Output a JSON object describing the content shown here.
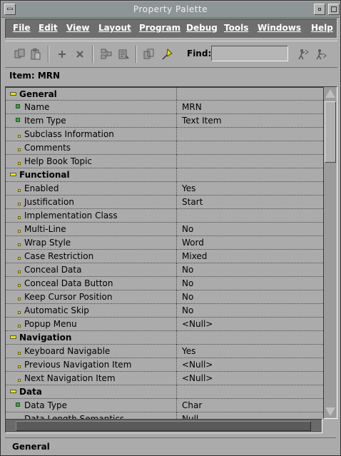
{
  "window": {
    "title": "Property Palette"
  },
  "menu": [
    "File",
    "Edit",
    "View",
    "Layout",
    "Program",
    "Debug",
    "Tools",
    "Windows",
    "Help"
  ],
  "toolbar": {
    "find_label": "Find:",
    "find_value": ""
  },
  "item": {
    "prefix": "Item:",
    "name": "MRN"
  },
  "rows": [
    {
      "type": "category",
      "name": "General",
      "value": ""
    },
    {
      "type": "prop",
      "marker": "set",
      "name": "Name",
      "value": "MRN"
    },
    {
      "type": "prop",
      "marker": "set",
      "name": "Item Type",
      "value": "Text Item"
    },
    {
      "type": "prop",
      "marker": "default",
      "name": "Subclass Information",
      "value": ""
    },
    {
      "type": "prop",
      "marker": "default",
      "name": "Comments",
      "value": ""
    },
    {
      "type": "prop",
      "marker": "default",
      "name": "Help Book Topic",
      "value": ""
    },
    {
      "type": "category",
      "name": "Functional",
      "value": ""
    },
    {
      "type": "prop",
      "marker": "default",
      "name": "Enabled",
      "value": "Yes"
    },
    {
      "type": "prop",
      "marker": "default",
      "name": "Justification",
      "value": "Start"
    },
    {
      "type": "prop",
      "marker": "default",
      "name": "Implementation Class",
      "value": ""
    },
    {
      "type": "prop",
      "marker": "default",
      "name": "Multi-Line",
      "value": "No"
    },
    {
      "type": "prop",
      "marker": "default",
      "name": "Wrap Style",
      "value": "Word"
    },
    {
      "type": "prop",
      "marker": "default",
      "name": "Case Restriction",
      "value": "Mixed"
    },
    {
      "type": "prop",
      "marker": "default",
      "name": "Conceal Data",
      "value": "No"
    },
    {
      "type": "prop",
      "marker": "default",
      "name": "Conceal Data Button",
      "value": "No"
    },
    {
      "type": "prop",
      "marker": "default",
      "name": "Keep Cursor Position",
      "value": "No"
    },
    {
      "type": "prop",
      "marker": "default",
      "name": "Automatic Skip",
      "value": "No"
    },
    {
      "type": "prop",
      "marker": "default",
      "name": "Popup Menu",
      "value": "<Null>"
    },
    {
      "type": "category",
      "name": "Navigation",
      "value": ""
    },
    {
      "type": "prop",
      "marker": "default",
      "name": "Keyboard Navigable",
      "value": "Yes"
    },
    {
      "type": "prop",
      "marker": "default",
      "name": "Previous Navigation Item",
      "value": "<Null>"
    },
    {
      "type": "prop",
      "marker": "default",
      "name": "Next Navigation Item",
      "value": "<Null>"
    },
    {
      "type": "category",
      "name": "Data",
      "value": ""
    },
    {
      "type": "prop",
      "marker": "set",
      "name": "Data Type",
      "value": "Char"
    },
    {
      "type": "prop",
      "marker": "default",
      "name": "Data Length Semantics",
      "value": "Null"
    }
  ],
  "status": {
    "text": "General"
  }
}
